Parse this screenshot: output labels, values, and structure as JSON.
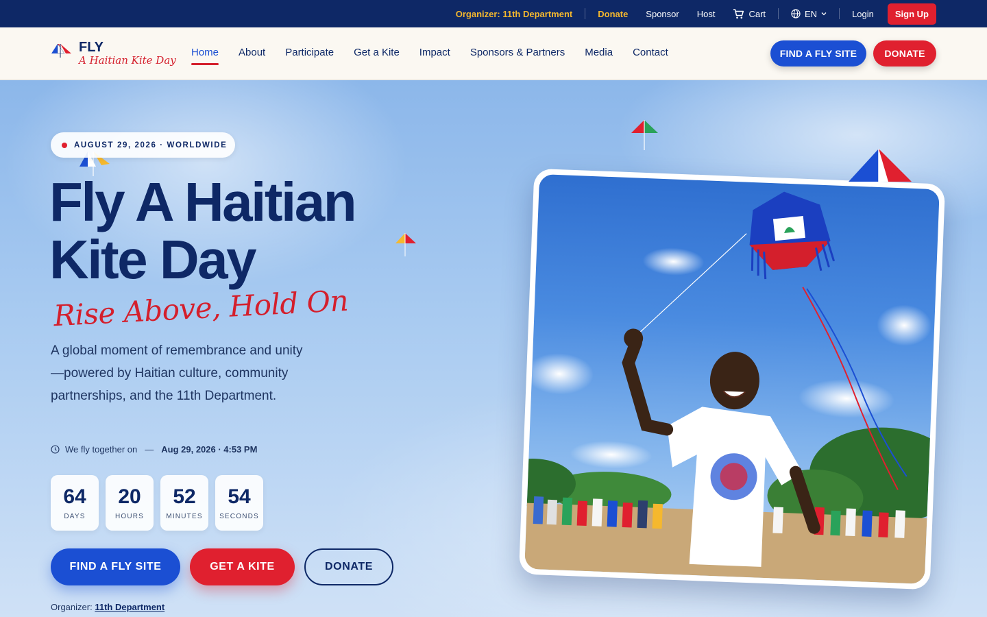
{
  "topbar": {
    "organizer": "Organizer: 11th Department",
    "donate": "Donate",
    "sponsor": "Sponsor",
    "host": "Host",
    "cart": "Cart",
    "language": "EN",
    "login": "Login",
    "signup": "Sign Up"
  },
  "brand": {
    "name": "FLY",
    "tagline": "A Haitian Kite Day"
  },
  "nav": {
    "links": [
      "Home",
      "About",
      "Participate",
      "Get a Kite",
      "Impact",
      "Sponsors & Partners",
      "Media",
      "Contact"
    ],
    "active": "Home",
    "find_button": "FIND A FLY SITE",
    "donate_button": "DONATE"
  },
  "hero": {
    "date_pill": "AUGUST 29, 2026 · WORLDWIDE",
    "title_line1": "Fly A Haitian",
    "title_line2": "Kite Day",
    "slogan": "Rise Above, Hold On",
    "description": "A global moment of remembrance and unity—powered by Haitian culture, community partnerships, and the 11th Department.",
    "fly_together_label": "We fly together on",
    "fly_together_when": "Aug 29, 2026 · 4:53 PM",
    "countdown": [
      {
        "value": "64",
        "label": "DAYS"
      },
      {
        "value": "20",
        "label": "HOURS"
      },
      {
        "value": "52",
        "label": "MINUTES"
      },
      {
        "value": "54",
        "label": "SECONDS"
      }
    ],
    "cta_find": "FIND A FLY SITE",
    "cta_kite": "GET A KITE",
    "cta_donate": "DONATE",
    "organizer_prefix": "Organizer:",
    "organizer_link": "11th Department"
  },
  "colors": {
    "navy": "#0e2866",
    "blue": "#1b4fd3",
    "red": "#e0202f",
    "gold": "#f5b82e",
    "cream": "#fbf8f2"
  },
  "icons": {
    "cart": "cart-icon",
    "language": "globe-icon",
    "chevron": "chevron-down-icon",
    "clock": "clock-icon"
  }
}
